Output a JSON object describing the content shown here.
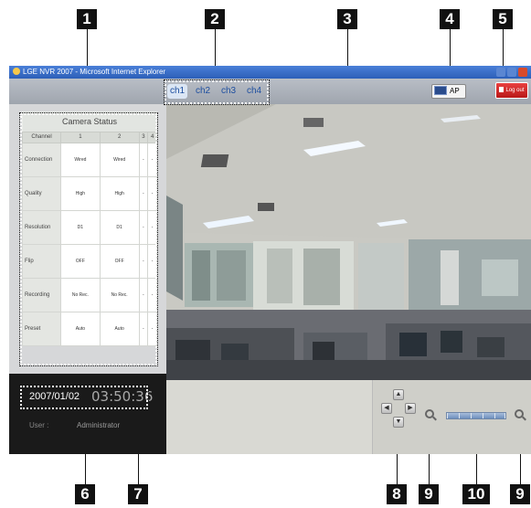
{
  "callouts": [
    "1",
    "2",
    "3",
    "4",
    "5",
    "6",
    "7",
    "8",
    "9",
    "10",
    "9"
  ],
  "window": {
    "title": "LGE NVR 2007 - Microsoft Internet Explorer"
  },
  "channels": [
    {
      "label": "ch1",
      "active": true
    },
    {
      "label": "ch2",
      "active": false
    },
    {
      "label": "ch3",
      "active": false
    },
    {
      "label": "ch4",
      "active": false
    }
  ],
  "toolbar": {
    "ap_label": "AP",
    "logout_label": "Log out"
  },
  "camera_status": {
    "title": "Camera Status",
    "columns": [
      "Channel",
      "1",
      "2",
      "3",
      "4"
    ],
    "rows": [
      {
        "label": "Connection",
        "values": [
          "Wired",
          "Wired",
          "-",
          "-"
        ]
      },
      {
        "label": "Quality",
        "values": [
          "High",
          "High",
          "-",
          "-"
        ]
      },
      {
        "label": "Resolution",
        "values": [
          "D1",
          "D1",
          "-",
          "-"
        ]
      },
      {
        "label": "Flip",
        "values": [
          "OFF",
          "OFF",
          "-",
          "-"
        ]
      },
      {
        "label": "Recording",
        "values": [
          "No Rec.",
          "No Rec.",
          "-",
          "-"
        ]
      },
      {
        "label": "Preset",
        "values": [
          "Auto",
          "Auto",
          "-",
          "-"
        ]
      }
    ]
  },
  "info": {
    "date": "2007/01/02",
    "time": "03:50:36",
    "user_label": "User :",
    "user_value": "Administrator"
  },
  "ptz": {
    "up_icon": "arrow-up-icon",
    "down_icon": "arrow-down-icon",
    "left_icon": "arrow-left-icon",
    "right_icon": "arrow-right-icon",
    "zoom_out_icon": "zoom-out-icon",
    "zoom_in_icon": "zoom-in-icon"
  },
  "colors": {
    "logout": "#d32626",
    "titlebar": "#2c5fb8",
    "active_tab": "#dbe6f4"
  }
}
